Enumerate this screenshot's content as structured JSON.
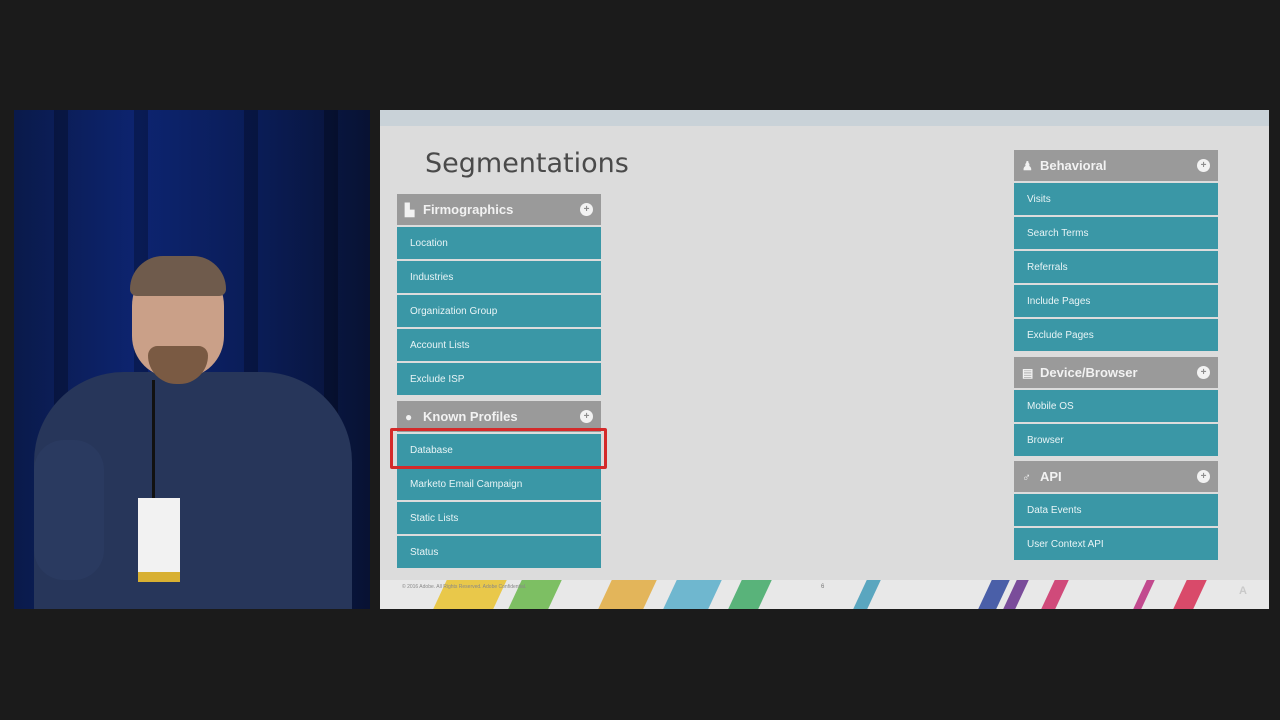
{
  "slide": {
    "title": "Segmentations",
    "footer_text": "© 2016 Adobe. All Rights Reserved. Adobe Confidential.",
    "footer_page": "6",
    "logo_text": "A"
  },
  "colors": {
    "item_bg": "#3a97a6",
    "header_bg": "#9a9a9a",
    "highlight": "#d42a2a"
  },
  "groups": {
    "firmographics": {
      "title": "Firmographics",
      "icon": "building-icon",
      "items": [
        "Location",
        "Industries",
        "Organization Group",
        "Account Lists",
        "Exclude ISP"
      ]
    },
    "known_profiles": {
      "title": "Known Profiles",
      "icon": "person-icon",
      "items": [
        "Database",
        "Marketo Email Campaign",
        "Static Lists",
        "Status"
      ]
    },
    "behavioral": {
      "title": "Behavioral",
      "icon": "people-icon",
      "items": [
        "Visits",
        "Search Terms",
        "Referrals",
        "Include Pages",
        "Exclude Pages"
      ]
    },
    "device_browser": {
      "title": "Device/Browser",
      "icon": "browser-icon",
      "items": [
        "Mobile OS",
        "Browser"
      ]
    },
    "api": {
      "title": "API",
      "icon": "plug-icon",
      "items": [
        "Data Events",
        "User Context API"
      ]
    }
  },
  "highlighted_item": "Database"
}
